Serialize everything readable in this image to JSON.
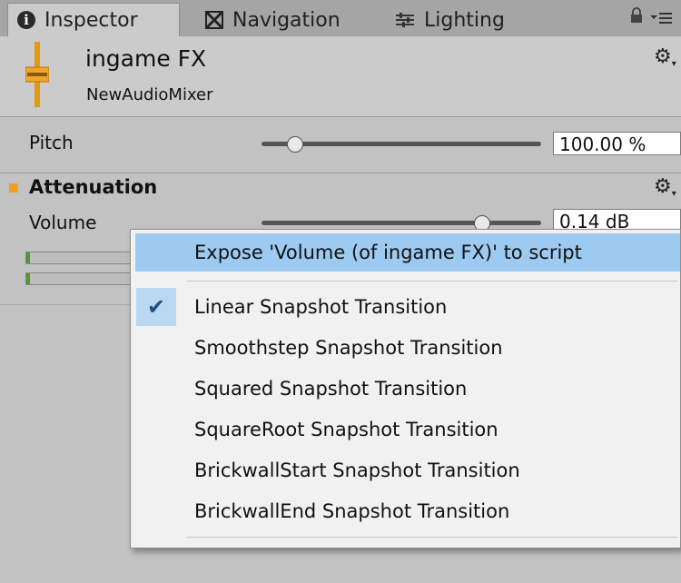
{
  "tabs": [
    {
      "label": "Inspector",
      "icon": "info-icon"
    },
    {
      "label": "Navigation",
      "icon": "navigation-icon"
    },
    {
      "label": "Lighting",
      "icon": "lighting-icon"
    }
  ],
  "header": {
    "title": "ingame FX",
    "subtitle": "NewAudioMixer",
    "icon": "audio-mixer-fader-icon"
  },
  "pitch": {
    "label": "Pitch",
    "value": "100.00 %",
    "slider_fraction": 0.12
  },
  "attenuation": {
    "section_title": "Attenuation",
    "volume_label": "Volume",
    "volume_value": "0.14 dB"
  },
  "context_menu": {
    "items": [
      {
        "label": "Expose 'Volume (of ingame FX)' to script",
        "highlighted": true
      },
      {
        "label": "Linear Snapshot Transition",
        "checked": true
      },
      {
        "label": "Smoothstep Snapshot Transition"
      },
      {
        "label": "Squared Snapshot Transition"
      },
      {
        "label": "SquareRoot Snapshot Transition"
      },
      {
        "label": "BrickwallStart Snapshot Transition"
      },
      {
        "label": "BrickwallEnd Snapshot Transition"
      }
    ]
  },
  "colors": {
    "highlight": "#9ccaf0",
    "section_marker": "#f0a020",
    "meter_fill": "#4c9a2a"
  }
}
